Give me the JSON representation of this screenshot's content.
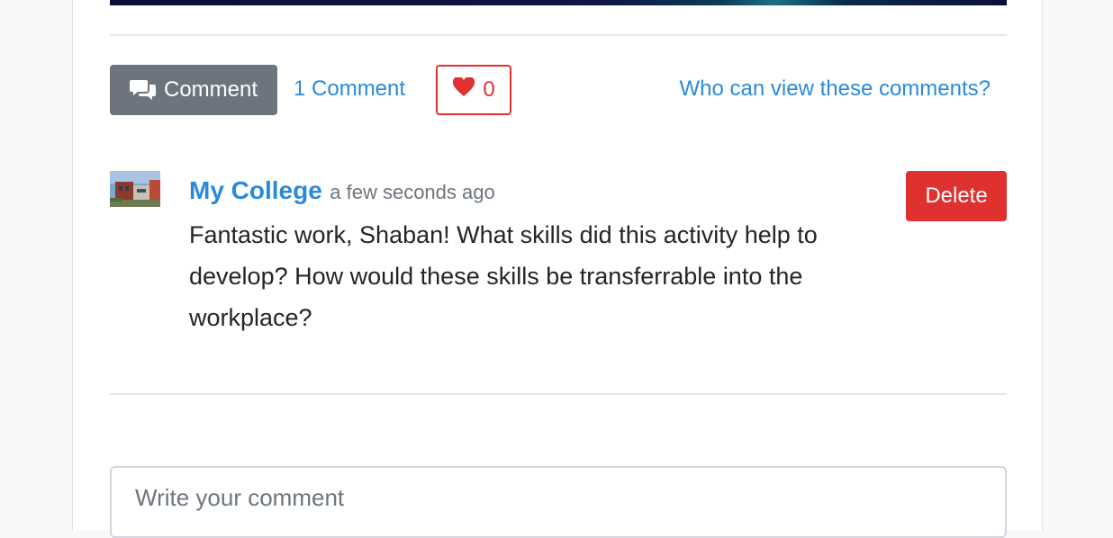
{
  "actions": {
    "comment_button_label": "Comment",
    "comment_count_label": "1 Comment",
    "like_count": "0",
    "visibility_link": "Who can view these comments?"
  },
  "comment": {
    "author": "My College",
    "timestamp": "a few seconds ago",
    "delete_label": "Delete",
    "text": "Fantastic work, Shaban! What skills did this activity help to develop? How would these skills be transferrable into the workplace?"
  },
  "composer": {
    "placeholder": "Write your comment"
  },
  "colors": {
    "link": "#2b8ad8",
    "danger": "#e03131",
    "secondary": "#6c757d"
  }
}
